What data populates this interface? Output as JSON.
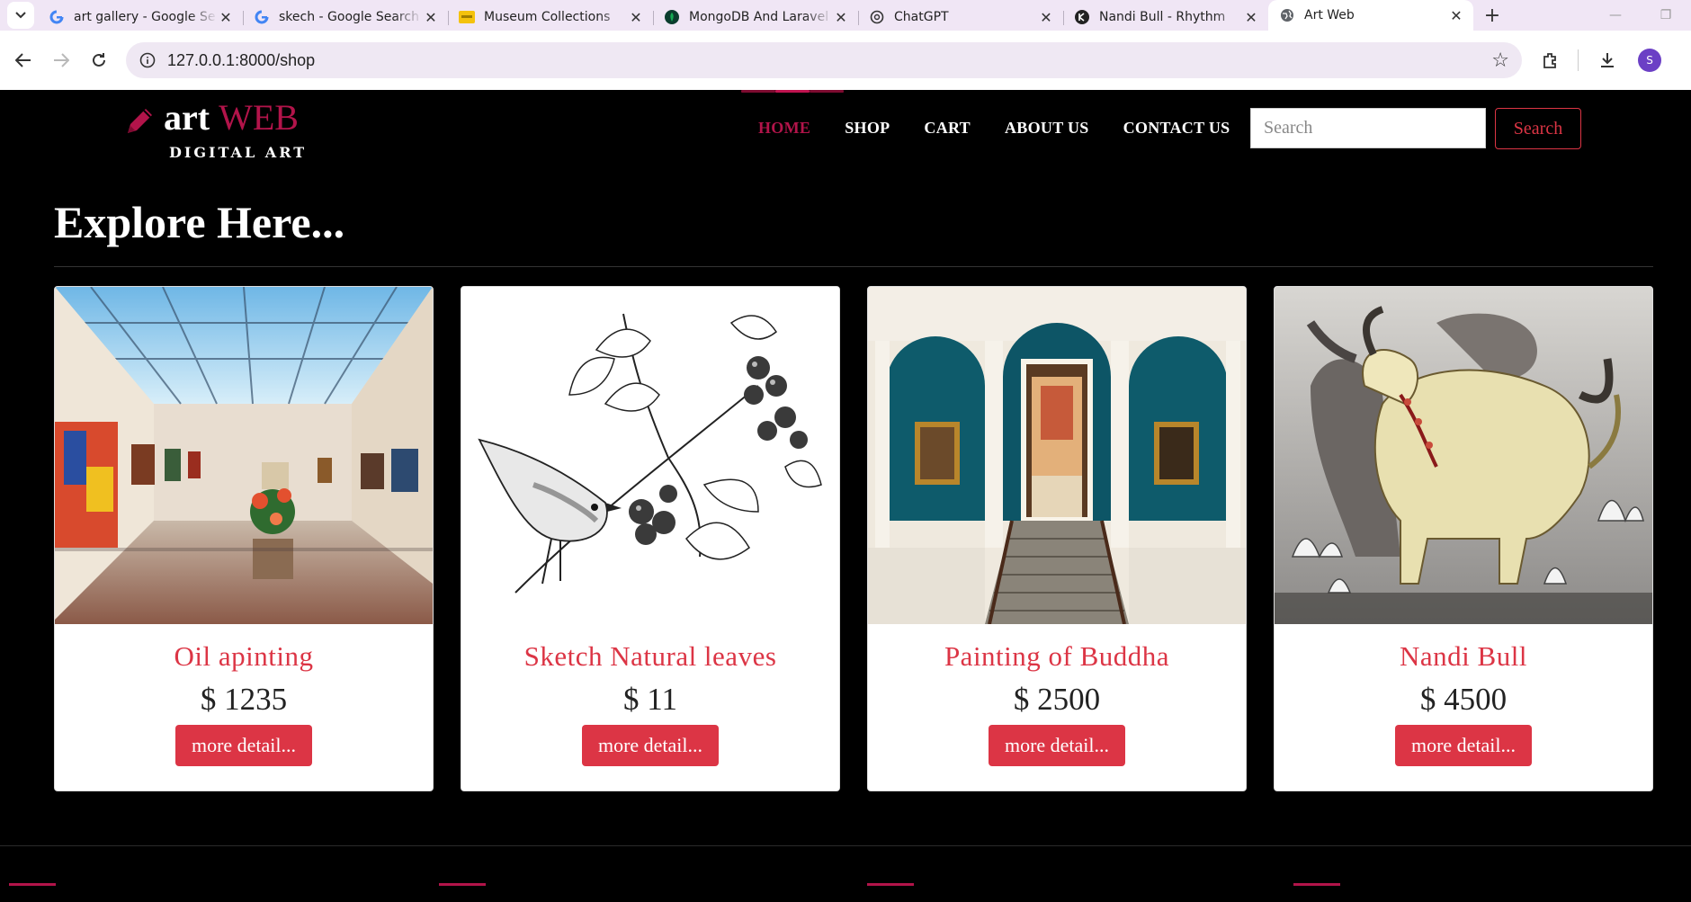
{
  "browser": {
    "tabs": [
      {
        "title": "art gallery - Google Se",
        "favicon": "google-icon",
        "active": false
      },
      {
        "title": "skech - Google Search",
        "favicon": "google-icon",
        "active": false
      },
      {
        "title": "Museum Collections",
        "favicon": "museum-icon",
        "active": false
      },
      {
        "title": "MongoDB And Laravel",
        "favicon": "mongodb-icon",
        "active": false
      },
      {
        "title": "ChatGPT",
        "favicon": "chatgpt-icon",
        "active": false
      },
      {
        "title": "Nandi Bull - Rhythm",
        "favicon": "rhythm-icon",
        "active": false
      },
      {
        "title": "Art Web",
        "favicon": "globe-icon",
        "active": true
      }
    ],
    "url": "127.0.0.1:8000/shop",
    "profile_initial": "S"
  },
  "site": {
    "logo": {
      "word1": "art",
      "word2": "WEB",
      "tagline": "DIGITAL ART"
    },
    "nav": [
      {
        "label": "HOME",
        "active": true
      },
      {
        "label": "SHOP",
        "active": false
      },
      {
        "label": "CART",
        "active": false
      },
      {
        "label": "ABOUT US",
        "active": false
      },
      {
        "label": "CONTACT US",
        "active": false
      }
    ],
    "search": {
      "placeholder": "Search",
      "button": "Search"
    },
    "page_title": "Explore Here...",
    "products": [
      {
        "title": "Oil apinting",
        "price": "$ 1235",
        "button": "more detail...",
        "image": "gallery-hall-image"
      },
      {
        "title": "Sketch Natural leaves",
        "price": "$ 11",
        "button": "more detail...",
        "image": "bird-sketch-image"
      },
      {
        "title": "Painting of Buddha",
        "price": "$ 2500",
        "button": "more detail...",
        "image": "museum-room-image"
      },
      {
        "title": "Nandi Bull",
        "price": "$ 4500",
        "button": "more detail...",
        "image": "nandi-bull-image"
      }
    ]
  },
  "colors": {
    "accent": "#b2144a",
    "button": "#dc3545",
    "background": "#000000"
  }
}
